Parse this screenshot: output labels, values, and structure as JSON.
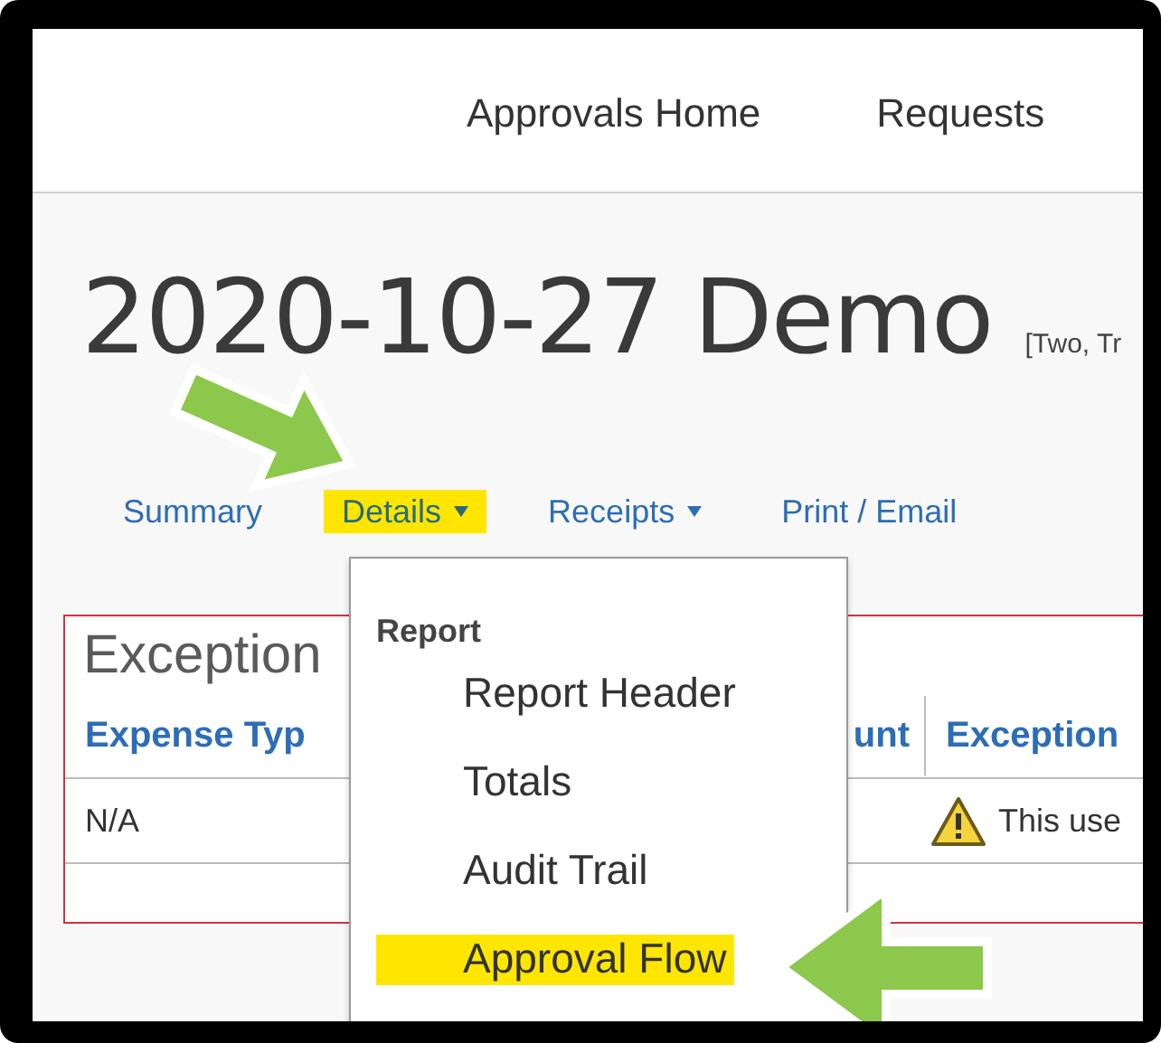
{
  "nav": {
    "items": [
      {
        "label": "Approvals Home"
      },
      {
        "label": "Requests"
      }
    ]
  },
  "report": {
    "title": "2020-10-27 Demo",
    "subtitle": "[Two, Tr"
  },
  "tabs": [
    {
      "label": "Summary",
      "has_menu": false,
      "highlighted": false
    },
    {
      "label": "Details",
      "has_menu": true,
      "highlighted": true
    },
    {
      "label": "Receipts",
      "has_menu": true,
      "highlighted": false
    },
    {
      "label": "Print / Email",
      "has_menu": false,
      "highlighted": false
    }
  ],
  "exceptions": {
    "title": "Exception",
    "columns": [
      "Expense Typ",
      "unt",
      "Exception"
    ],
    "rows": [
      {
        "expense_type": "N/A",
        "warning": true,
        "exception": "This use"
      }
    ]
  },
  "details_menu": {
    "group": "Report",
    "items": [
      {
        "label": "Report Header",
        "highlighted": false
      },
      {
        "label": "Totals",
        "highlighted": false
      },
      {
        "label": "Audit Trail",
        "highlighted": false
      },
      {
        "label": "Approval Flow",
        "highlighted": true
      }
    ]
  }
}
